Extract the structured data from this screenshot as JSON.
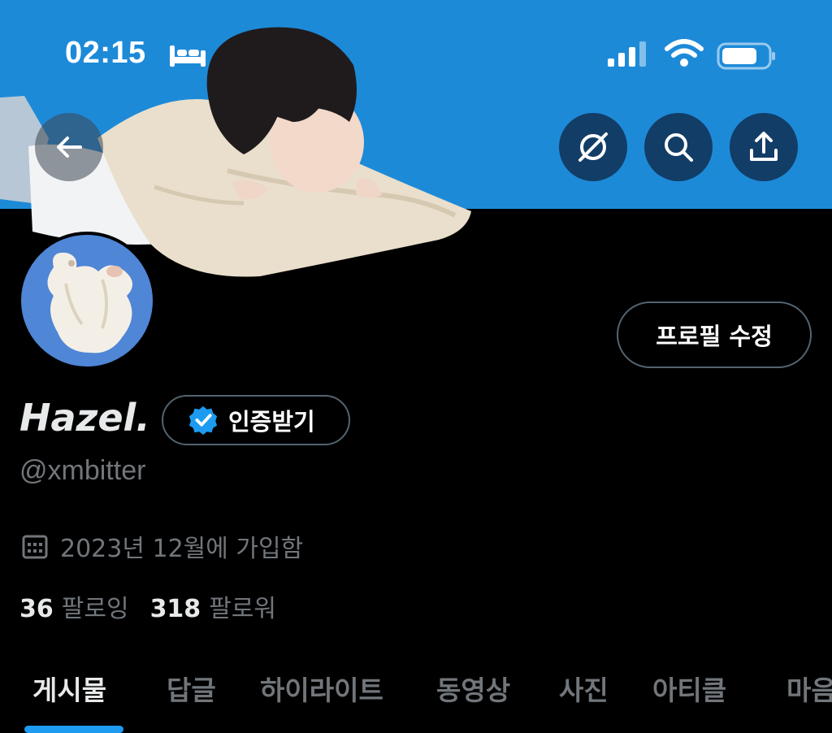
{
  "status_bar": {
    "time": "02:15",
    "icons": [
      "bed-icon",
      "signal-icon",
      "wifi-icon",
      "battery-icon"
    ]
  },
  "header": {
    "buttons": [
      "back-arrow-icon",
      "grok-icon",
      "search-icon",
      "share-icon"
    ]
  },
  "profile": {
    "edit_button": "프로필 수정",
    "display_name": "Hazel.",
    "verify_button": "인증받기",
    "handle": "@xmbitter",
    "joined": "2023년 12월에 가입함",
    "following_count": "36",
    "following_label": "팔로잉",
    "followers_count": "318",
    "followers_label": "팔로워"
  },
  "tabs": [
    {
      "label": "게시물",
      "active": true
    },
    {
      "label": "답글",
      "active": false
    },
    {
      "label": "하이라이트",
      "active": false
    },
    {
      "label": "동영상",
      "active": false
    },
    {
      "label": "사진",
      "active": false
    },
    {
      "label": "아티클",
      "active": false
    },
    {
      "label": "마음",
      "active": false
    }
  ],
  "colors": {
    "banner": "#1d8ad8",
    "background": "#000000",
    "accent": "#1d9bf0",
    "muted_text": "#71767b",
    "avatar_bg": "#4f86d6"
  }
}
